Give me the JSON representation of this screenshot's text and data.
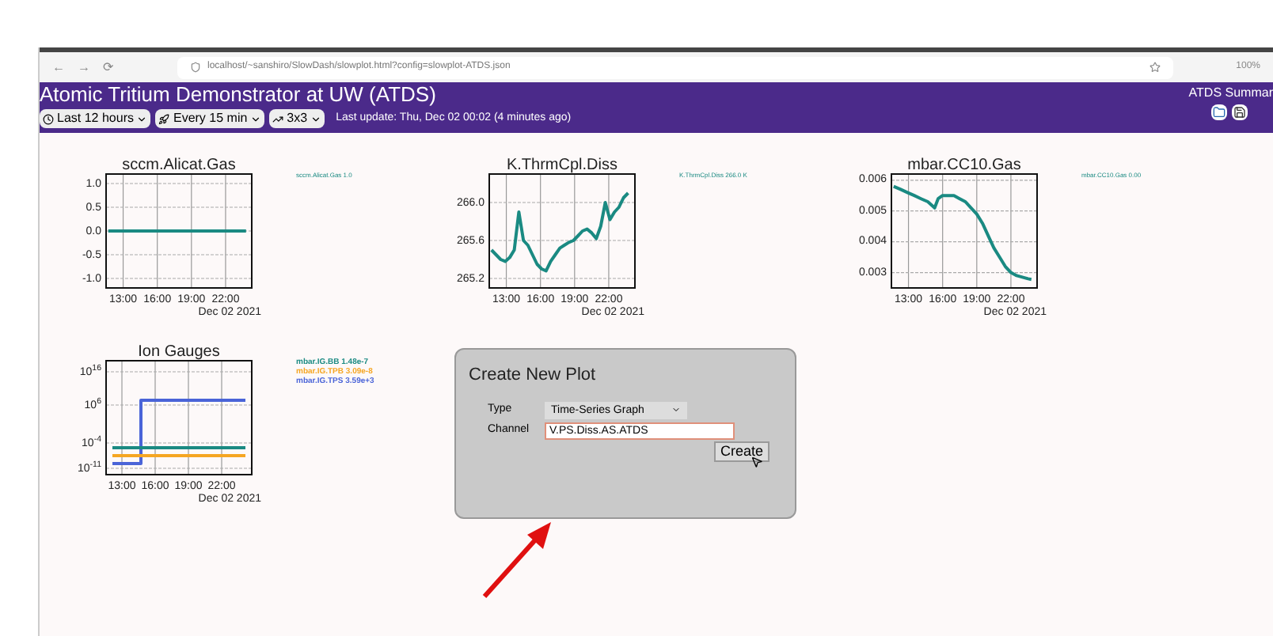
{
  "browser": {
    "nav": [
      "←",
      "→",
      "⟳"
    ],
    "url": "localhost/~sanshiro/SlowDash/slowplot.html?config=slowplot-ATDS.json",
    "zoom": "100%"
  },
  "header": {
    "title": "Atomic Tritium Demonstrator at UW (ATDS)",
    "link": "ATDS Summar",
    "selects": [
      "Last 12 hours",
      "Every 15 min",
      "3x3"
    ],
    "last_update": "Last update: Thu, Dec 02 00:02 (4 minutes ago)"
  },
  "plots": [
    {
      "chart_data": {
        "type": "line",
        "title": "sccm.Alicat.Gas",
        "grid": true,
        "x": [
          11.7,
          23.8
        ],
        "series": [
          {
            "name": "sccm.Alicat.Gas 1.0",
            "color": "#1a8a82",
            "values": [
              0,
              0
            ]
          }
        ],
        "xlim": [
          11.5,
          24.3
        ],
        "ylim": [
          -1.2,
          1.2
        ],
        "xticks": [
          {
            "value": 13,
            "label": "13:00"
          },
          {
            "value": 16,
            "label": "16:00"
          },
          {
            "value": 19,
            "label": "19:00"
          },
          {
            "value": 22,
            "label": "22:00"
          }
        ],
        "yticks": [
          {
            "value": -1,
            "label": "-1.0"
          },
          {
            "value": -0.5,
            "label": "-0.5"
          },
          {
            "value": 0,
            "label": "0.0"
          },
          {
            "value": 0.5,
            "label": "0.5"
          },
          {
            "value": 1,
            "label": "1.0"
          }
        ],
        "annotations": [
          "Dec 02 2021"
        ]
      }
    },
    {
      "chart_data": {
        "type": "line",
        "title": "K.ThrmCpl.Diss",
        "grid": true,
        "x": [
          11.7,
          12.1,
          12.5,
          12.9,
          13.3,
          13.7,
          14.1,
          14.5,
          14.9,
          15.3,
          15.7,
          16.1,
          16.5,
          16.9,
          17.3,
          17.7,
          18.1,
          18.5,
          18.9,
          19.3,
          19.7,
          20.1,
          20.5,
          20.9,
          21.3,
          21.7,
          22.1,
          22.5,
          22.9,
          23.3,
          23.7
        ],
        "series": [
          {
            "name": "K.ThrmCpl.Diss 266.0 K",
            "color": "#1a8a82",
            "values": [
              265.5,
              265.45,
              265.4,
              265.38,
              265.42,
              265.5,
              265.9,
              265.6,
              265.55,
              265.45,
              265.35,
              265.3,
              265.28,
              265.38,
              265.45,
              265.52,
              265.55,
              265.58,
              265.6,
              265.65,
              265.7,
              265.72,
              265.68,
              265.62,
              265.75,
              266.0,
              265.82,
              265.9,
              265.95,
              266.05,
              266.1
            ]
          }
        ],
        "xlim": [
          11.5,
          24.3
        ],
        "ylim": [
          265.1,
          266.3
        ],
        "xticks": [
          {
            "value": 13,
            "label": "13:00"
          },
          {
            "value": 16,
            "label": "16:00"
          },
          {
            "value": 19,
            "label": "19:00"
          },
          {
            "value": 22,
            "label": "22:00"
          }
        ],
        "yticks": [
          {
            "value": 265.2,
            "label": "265.2"
          },
          {
            "value": 265.6,
            "label": "265.6"
          },
          {
            "value": 266.0,
            "label": "266.0"
          }
        ],
        "annotations": [
          "Dec 02 2021"
        ]
      }
    },
    {
      "chart_data": {
        "type": "line",
        "title": "mbar.CC10.Gas",
        "grid": true,
        "x": [
          11.7,
          12.3,
          12.9,
          13.5,
          14.1,
          14.7,
          15.3,
          15.6,
          16.0,
          16.5,
          17.0,
          17.5,
          18.0,
          18.5,
          19.0,
          19.5,
          20.0,
          20.5,
          21.0,
          21.5,
          22.0,
          22.5,
          23.0,
          23.5,
          23.8
        ],
        "series": [
          {
            "name": "mbar.CC10.Gas 0.00",
            "color": "#1a8a82",
            "values": [
              0.0058,
              0.0057,
              0.0056,
              0.0055,
              0.0054,
              0.0053,
              0.0051,
              0.0054,
              0.0055,
              0.0055,
              0.0055,
              0.0054,
              0.0053,
              0.0051,
              0.0049,
              0.0046,
              0.0042,
              0.0038,
              0.0035,
              0.0032,
              0.003,
              0.0029,
              0.00285,
              0.0028,
              0.00278
            ]
          }
        ],
        "xlim": [
          11.5,
          24.3
        ],
        "ylim": [
          0.0025,
          0.0062
        ],
        "xticks": [
          {
            "value": 13,
            "label": "13:00"
          },
          {
            "value": 16,
            "label": "16:00"
          },
          {
            "value": 19,
            "label": "19:00"
          },
          {
            "value": 22,
            "label": "22:00"
          }
        ],
        "yticks": [
          {
            "value": 0.003,
            "label": "0.003"
          },
          {
            "value": 0.004,
            "label": "0.004"
          },
          {
            "value": 0.005,
            "label": "0.005"
          },
          {
            "value": 0.006,
            "label": "0.006"
          }
        ],
        "annotations": [
          "Dec 02 2021"
        ]
      }
    },
    {
      "title": "Ion Gauges",
      "legend": [
        {
          "text": "mbar.IG.BB 1.48e-7",
          "color": "#1a8a82"
        },
        {
          "text": "mbar.IG.TPB 3.09e-8",
          "color": "#f5a623"
        },
        {
          "text": "mbar.IG.TPS 3.59e+3",
          "color": "#4a64d8"
        }
      ],
      "y_labels": [
        "10$^{16}$",
        "10$^{6}$",
        "10$^{-4}$",
        "10$^{-11}$"
      ],
      "x_labels": [
        "13:00",
        "16:00",
        "19:00",
        "22:00"
      ],
      "date": "Dec 02 2021"
    }
  ],
  "create_panel": {
    "title": "Create New Plot",
    "type_label": "Type",
    "type_value": "Time-Series Graph",
    "channel_label": "Channel",
    "channel_value": "V.PS.Diss.AS.ATDS",
    "button": "Create"
  }
}
